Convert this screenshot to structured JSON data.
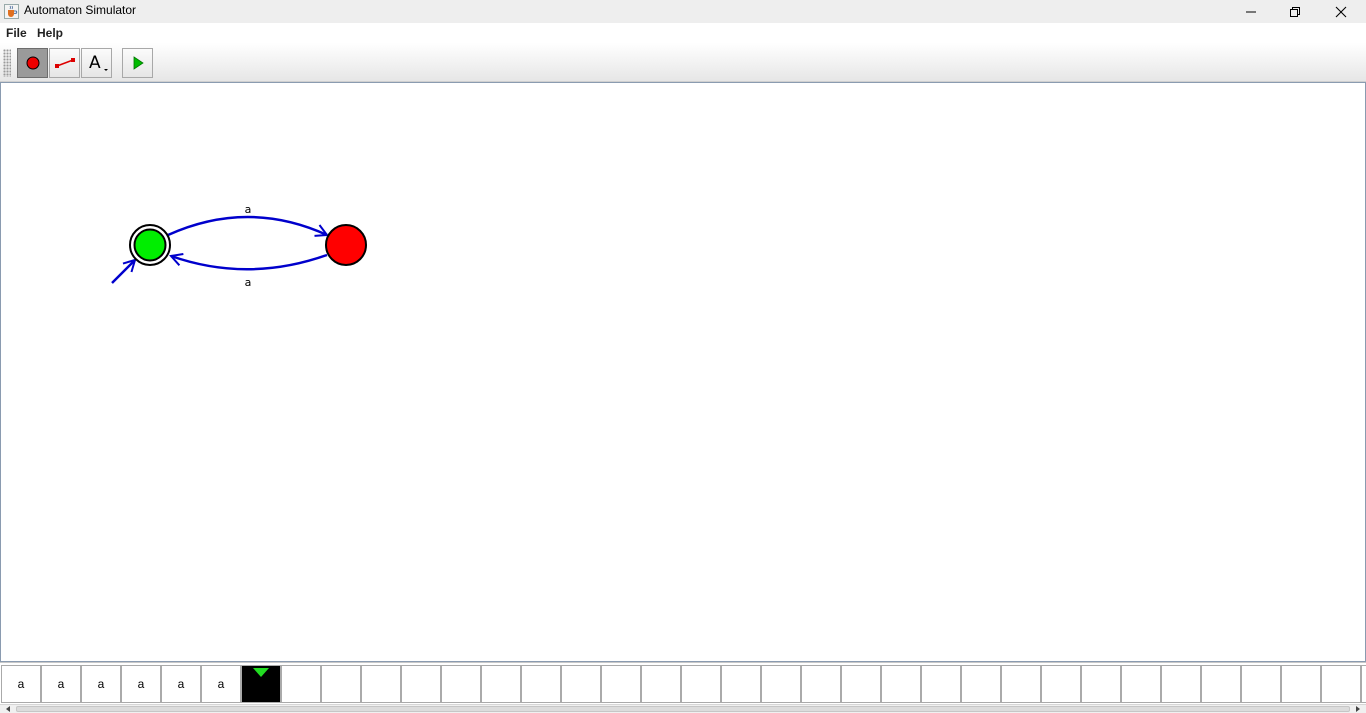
{
  "window": {
    "title": "Automaton Simulator",
    "icon": "java-cup-icon"
  },
  "menu": {
    "items": [
      {
        "label": "File"
      },
      {
        "label": "Help"
      }
    ]
  },
  "toolbar": {
    "tools": [
      {
        "name": "add-state-tool",
        "icon": "red-circle-icon",
        "selected": true
      },
      {
        "name": "add-transition-tool",
        "icon": "transition-line-icon",
        "selected": false
      },
      {
        "name": "label-tool",
        "icon": "text-label-icon",
        "selected": false
      },
      {
        "name": "run-tool",
        "icon": "play-icon",
        "selected": false
      }
    ]
  },
  "automaton": {
    "states": [
      {
        "id": "q0",
        "initial": true,
        "accepting": true,
        "fill": "#00ee00"
      },
      {
        "id": "q1",
        "initial": false,
        "accepting": false,
        "fill": "#ff0000"
      }
    ],
    "transitions": [
      {
        "from": "q0",
        "to": "q1",
        "symbol": "a"
      },
      {
        "from": "q1",
        "to": "q0",
        "symbol": "a"
      }
    ],
    "edge_color": "#0000cc"
  },
  "tape": {
    "cells": [
      "a",
      "a",
      "a",
      "a",
      "a",
      "a",
      "",
      "",
      "",
      "",
      "",
      "",
      "",
      "",
      "",
      "",
      "",
      "",
      "",
      "",
      "",
      "",
      "",
      "",
      "",
      "",
      "",
      "",
      "",
      "",
      "",
      "",
      "",
      "",
      ""
    ],
    "head_index": 6,
    "head_color": "#22dd22"
  }
}
